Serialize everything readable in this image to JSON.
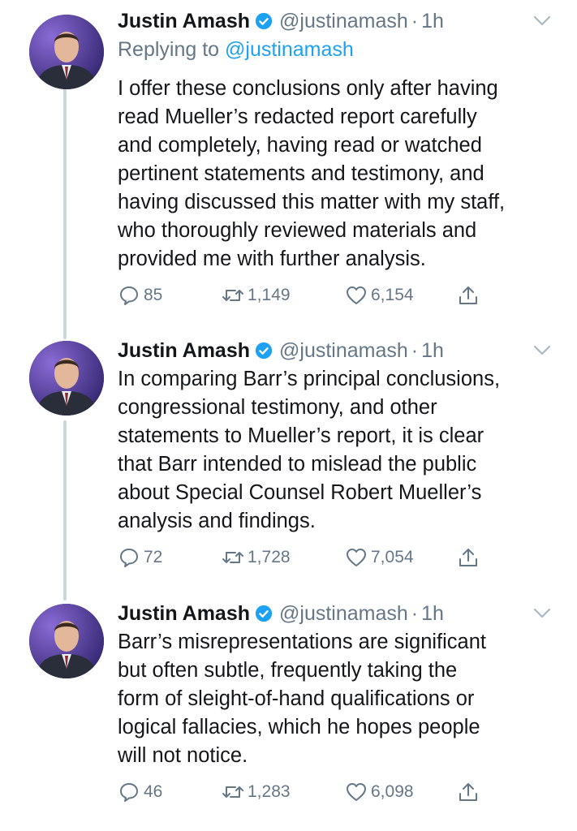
{
  "tweets": [
    {
      "name": "Justin Amash",
      "handle": "@justinamash",
      "separator": "·",
      "time": "1h",
      "reply_prefix": "Replying to ",
      "reply_handle": "@justinamash",
      "text": "I offer these conclusions only after having\nread Mueller’s redacted report carefully\nand completely, having read or watched\npertinent statements and testimony, and\nhaving discussed this matter with my staff,\nwho thoroughly reviewed materials and\nprovided me with further analysis.",
      "replies": "85",
      "retweets": "1,149",
      "likes": "6,154"
    },
    {
      "name": "Justin Amash",
      "handle": "@justinamash",
      "separator": "·",
      "time": "1h",
      "text": "In comparing Barr’s principal conclusions,\ncongressional testimony, and other\nstatements to Mueller’s report, it is clear\nthat Barr intended to mislead the public\nabout Special Counsel Robert Mueller’s\nanalysis and findings.",
      "replies": "72",
      "retweets": "1,728",
      "likes": "7,054"
    },
    {
      "name": "Justin Amash",
      "handle": "@justinamash",
      "separator": "·",
      "time": "1h",
      "text": "Barr’s misrepresentations are significant\nbut often subtle, frequently taking the\nform of sleight-of-hand qualifications or\nlogical fallacies, which he hopes people\nwill not notice.",
      "replies": "46",
      "retweets": "1,283",
      "likes": "6,098"
    }
  ],
  "colors": {
    "text": "#14171a",
    "muted": "#657786",
    "link": "#1da1f2",
    "verified": "#1da1f2",
    "thread_line": "#ccd6dd"
  },
  "icons": [
    "reply-icon",
    "retweet-icon",
    "like-icon",
    "share-icon",
    "verified-badge-icon",
    "caret-down-icon"
  ]
}
